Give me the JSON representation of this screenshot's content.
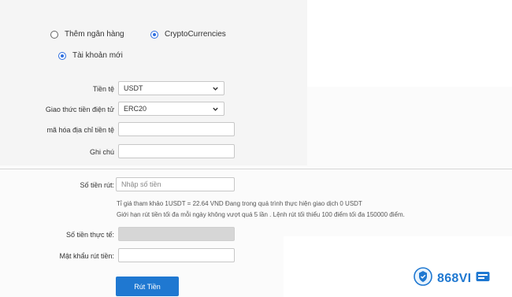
{
  "options": {
    "bank": "Thêm ngân hàng",
    "crypto": "CryptoCurrencies",
    "new_account": "Tài khoản mới"
  },
  "form": {
    "currency_label": "Tiền tệ",
    "currency_value": "USDT",
    "protocol_label": "Giao thức tiền điện tử",
    "protocol_value": "ERC20",
    "address_label": "mã hóa địa chỉ tiền tệ",
    "address_value": "",
    "note_label": "Ghi chú",
    "note_value": "",
    "amount_label": "Số tiền rút:",
    "amount_placeholder": "Nhập số tiền",
    "rate_info": "Tỉ giá tham khảo 1USDT = 22.64 VND Đang trong quá trình thực hiện giao dịch 0 USDT",
    "limit_info": "Giới hạn rút tiền tối đa mỗi ngày không vượt quá 5 lần . Lệnh rút tối thiểu 100 điểm tối đa 150000 điểm.",
    "actual_label": "Số tiền thực tế:",
    "actual_value": "",
    "password_label": "Mật khẩu rút tiền:",
    "password_value": "",
    "submit_label": "Rút Tiền"
  },
  "brand": {
    "text": "868VI",
    "color": "#1f78d1",
    "icon": "shield-crest-icon"
  }
}
